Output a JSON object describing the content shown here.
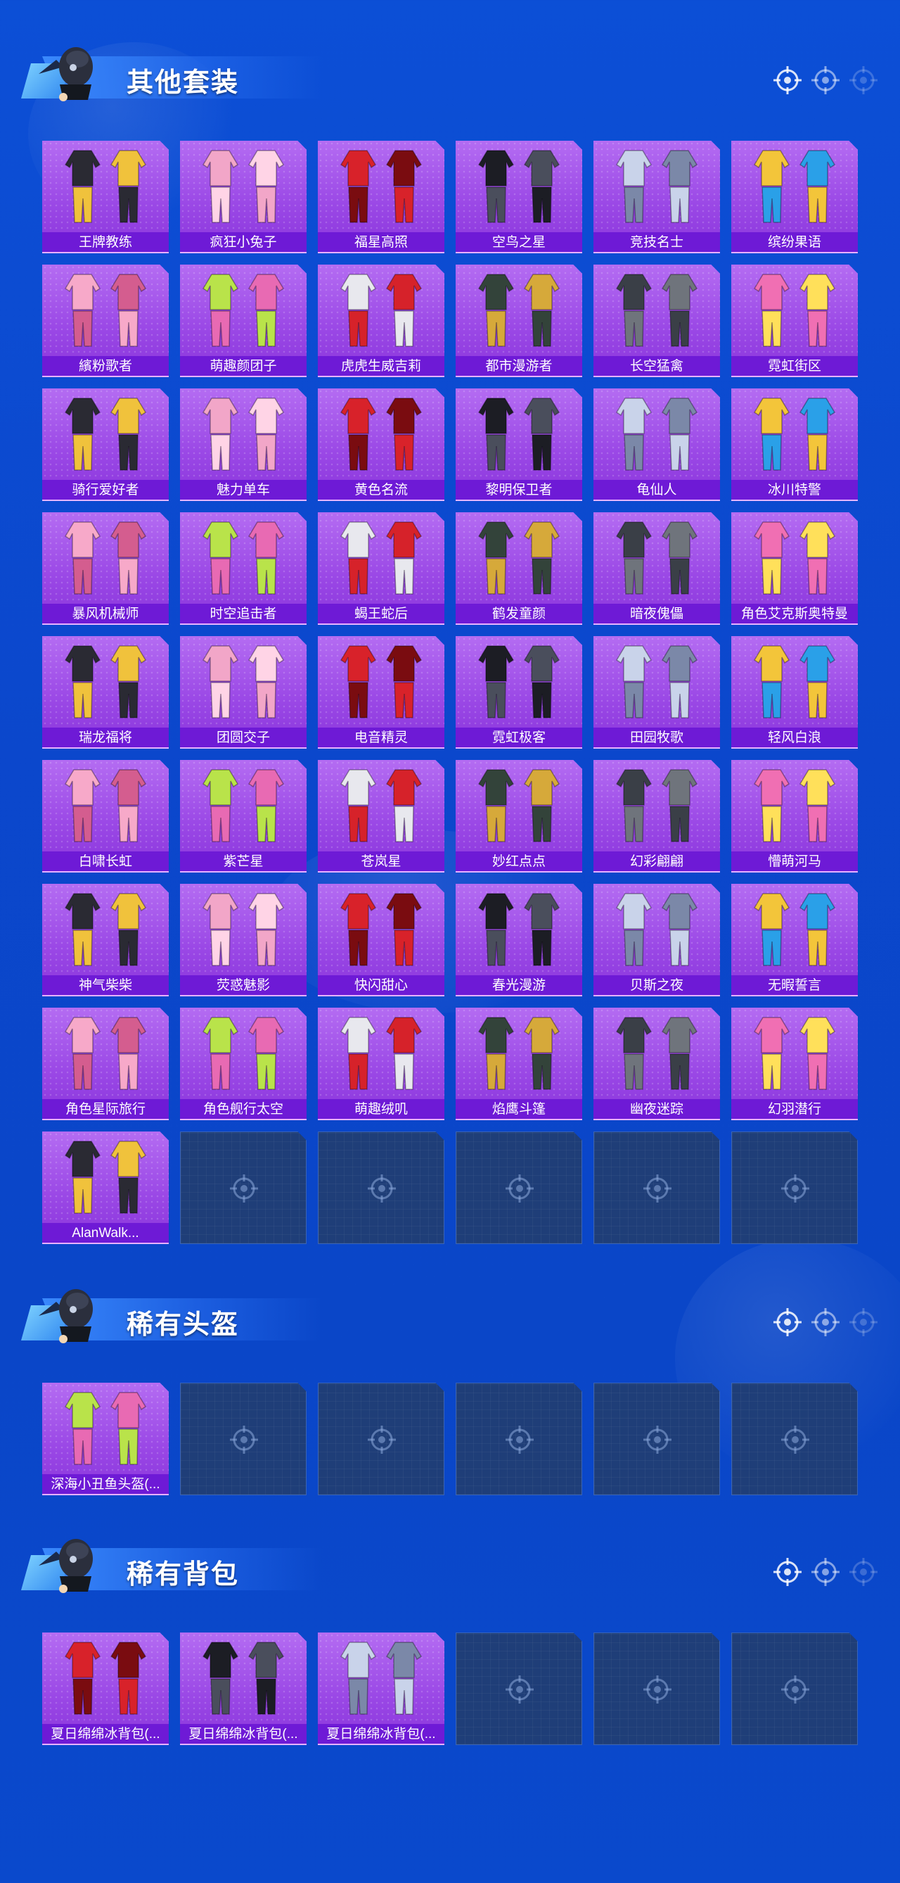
{
  "colors": {
    "background": "#0b4bd0",
    "tile_purple": "#9b49e6",
    "label_bar": "#6e1ad6",
    "empty_tile": "#1f3e78"
  },
  "sections": [
    {
      "title": "其他套装",
      "items": [
        "王牌教练",
        "疯狂小兔子",
        "福星高照",
        "空鸟之星",
        "竞技名士",
        "缤纷果语",
        "繽粉歌者",
        "萌趣颜团子",
        "虎虎生威吉莉",
        "都市漫游者",
        "长空猛禽",
        "霓虹街区",
        "骑行爱好者",
        "魅力单车",
        "黄色名流",
        "黎明保卫者",
        "龟仙人",
        "冰川特警",
        "暴风机械师",
        "时空追击者",
        "蝎王蛇后",
        "鹤发童颜",
        "暗夜傀儡",
        "角色艾克斯奥特曼",
        "瑞龙福将",
        "团圆交子",
        "电音精灵",
        "霓虹极客",
        "田园牧歌",
        "轻风白浪",
        "白啸长虹",
        "紫芒星",
        "苍岚星",
        "妙红点点",
        "幻彩翩翩",
        "懵萌河马",
        "神气柴柴",
        "荧惑魅影",
        "快闪甜心",
        "春光漫游",
        "贝斯之夜",
        "无暇誓言",
        "角色星际旅行",
        "角色舰行太空",
        "萌趣绒叽",
        "焰鹰斗篷",
        "幽夜迷踪",
        "幻羽潜行",
        "AlanWalk..."
      ],
      "empty_slots": 5
    },
    {
      "title": "稀有头盔",
      "items": [
        "深海小丑鱼头盔(..."
      ],
      "empty_slots": 5
    },
    {
      "title": "稀有背包",
      "items": [
        "夏日绵绵冰背包(...",
        "夏日绵绵冰背包(...",
        "夏日绵绵冰背包(..."
      ],
      "empty_slots": 3
    }
  ],
  "icons": {
    "header_mascot": "mascot-icon",
    "header_crosshair": "crosshair-icon",
    "empty_slot": "crosshair-icon"
  }
}
